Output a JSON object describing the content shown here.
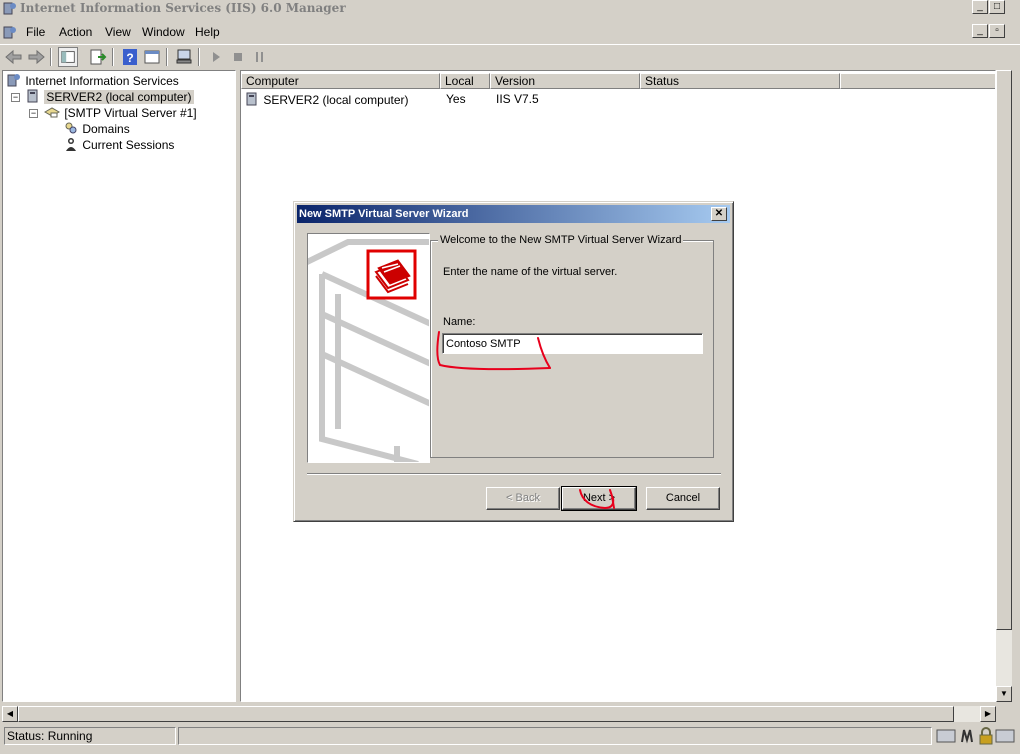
{
  "window": {
    "title": "Internet Information Services (IIS) 6.0 Manager",
    "controls": [
      "_",
      "□"
    ]
  },
  "menu": [
    "File",
    "Action",
    "View",
    "Window",
    "Help"
  ],
  "toolbar_icons": [
    "back-icon",
    "forward-icon",
    "show-hide-tree-icon",
    "export-list-icon",
    "help-icon",
    "properties-icon",
    "connect-icon",
    "start-icon",
    "stop-icon",
    "pause-icon"
  ],
  "tree": {
    "root": "Internet Information Services",
    "server": "SERVER2 (local computer)",
    "virtual_server": "[SMTP Virtual Server #1]",
    "domains": "Domains",
    "sessions": "Current Sessions"
  },
  "list": {
    "columns": [
      "Computer",
      "Local",
      "Version",
      "Status"
    ],
    "rows": [
      {
        "computer": "SERVER2 (local computer)",
        "local": "Yes",
        "version": "IIS V7.5",
        "status": ""
      }
    ]
  },
  "dialog": {
    "title": "New SMTP Virtual Server Wizard",
    "close": "✕",
    "group_title": "Welcome to the New SMTP Virtual Server Wizard",
    "intro": "Enter the name of the virtual server.",
    "name_label": "Name:",
    "name_value": "Contoso SMTP",
    "back": "< Back",
    "next": "Next >",
    "cancel": "Cancel"
  },
  "status": {
    "text": "Status: Running"
  },
  "colors": {
    "annotation": "#e8001c",
    "dialog_title_start": "#0a246a",
    "dialog_title_end": "#a6caf0"
  }
}
